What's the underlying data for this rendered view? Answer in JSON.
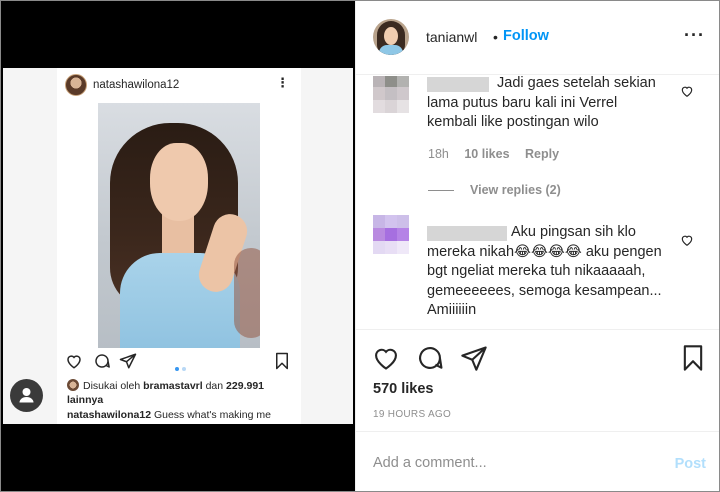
{
  "embedded_post": {
    "username": "natashawilona12",
    "more_glyph": "⋮",
    "liked_by_prefix": "Disukai oleh",
    "liked_by_user": "bramastavrl",
    "liked_by_middle": "dan",
    "liked_by_count": "229.991",
    "liked_by_suffix": "lainnya",
    "caption_user": "natashawilona12",
    "caption_text": "Guess what's making me"
  },
  "header": {
    "username": "tanianwl",
    "separator": "•",
    "follow_label": "Follow",
    "more_glyph": "···"
  },
  "comments": [
    {
      "text": "Jadi gaes setelah sekian lama putus baru kali ini Verrel kembali like postingan wilo",
      "time": "18h",
      "likes": "10 likes",
      "reply_label": "Reply",
      "view_replies": "View replies (2)"
    },
    {
      "text": "Aku pingsan sih klo mereka nikah😂😂😂😂 aku pengen bgt ngeliat mereka tuh nikaaaaah, gemeeeeees, semoga kesampean... Amiiiiiin"
    }
  ],
  "likes": "570 likes",
  "time_ago": "19 HOURS AGO",
  "add_comment": {
    "placeholder": "Add a comment...",
    "post_label": "Post"
  },
  "colors": {
    "follow": "#0095f6",
    "post_disabled": "#b2dffc",
    "meta": "#8e8e8e",
    "media_bg": "#000000"
  }
}
